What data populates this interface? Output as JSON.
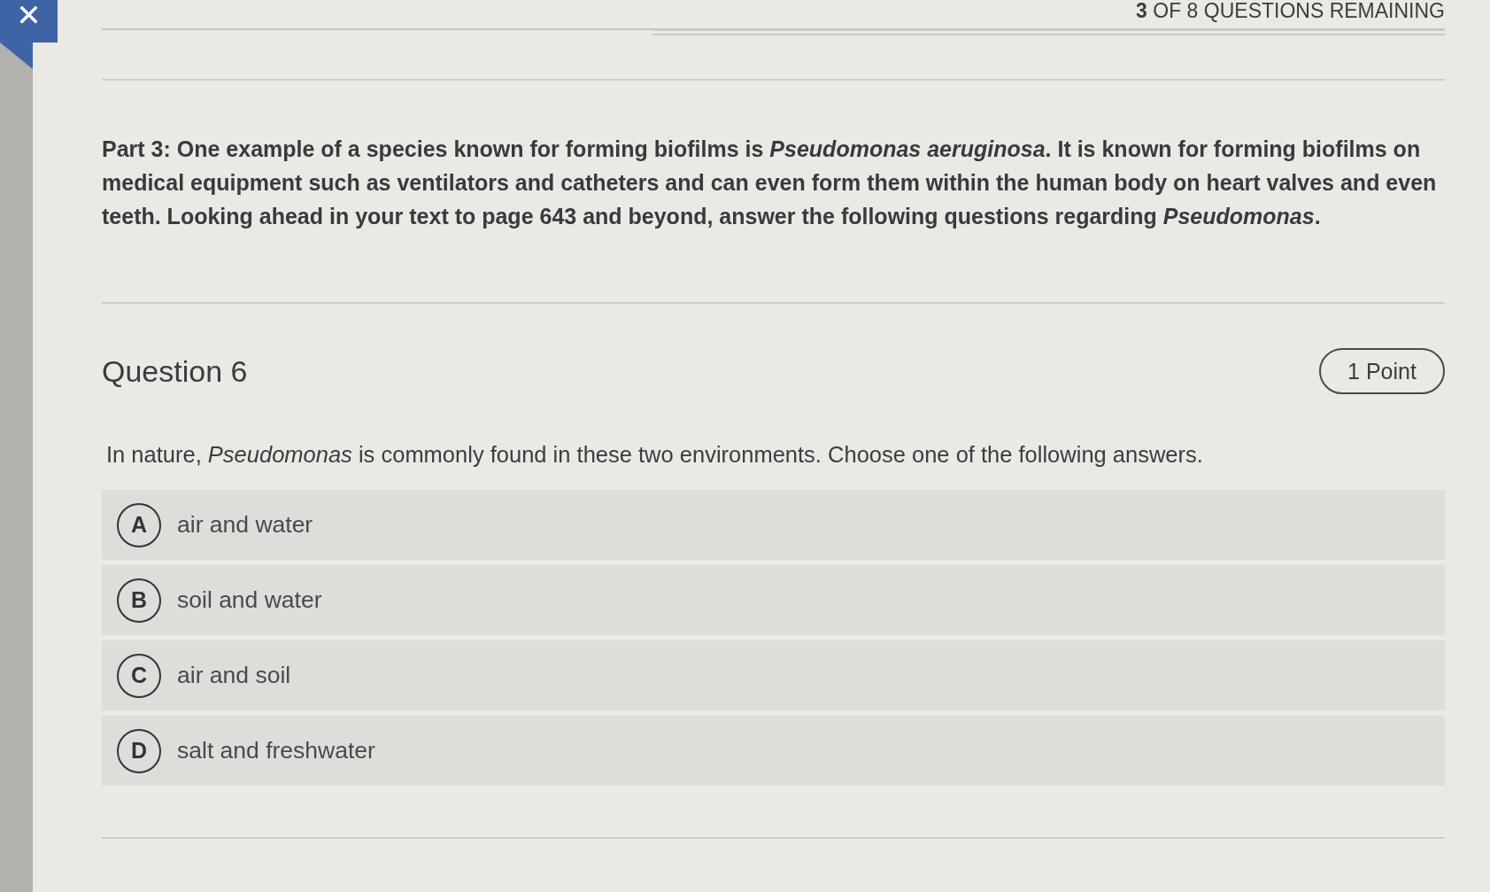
{
  "close_button": {
    "label": "✕"
  },
  "header": {
    "remaining": "**3** OF 8 QUESTIONS REMAINING",
    "progress": {
      "level": 0.59
    }
  },
  "passage": "Part 3: One example of a species known for forming biofilms is *Pseudomonas aeruginosa*. It is known for forming biofilms on medical equipment such as ventilators and catheters and can even form them within the human body on heart valves and even teeth. Looking ahead in your text to page 643 and beyond, answer the following questions regarding *Pseudomonas*.",
  "question": {
    "title": "Question 6",
    "points": "1 Point",
    "prompt": "In nature, *Pseudomonas* is commonly found in these two environments. Choose one of the following answers.",
    "options": [
      {
        "letter": "A",
        "text": "air and water",
        "selected": false
      },
      {
        "letter": "B",
        "text": "soil and water",
        "selected": false
      },
      {
        "letter": "C",
        "text": "air and soil",
        "selected": false
      },
      {
        "letter": "D",
        "text": "salt and freshwater",
        "selected": false
      }
    ]
  }
}
